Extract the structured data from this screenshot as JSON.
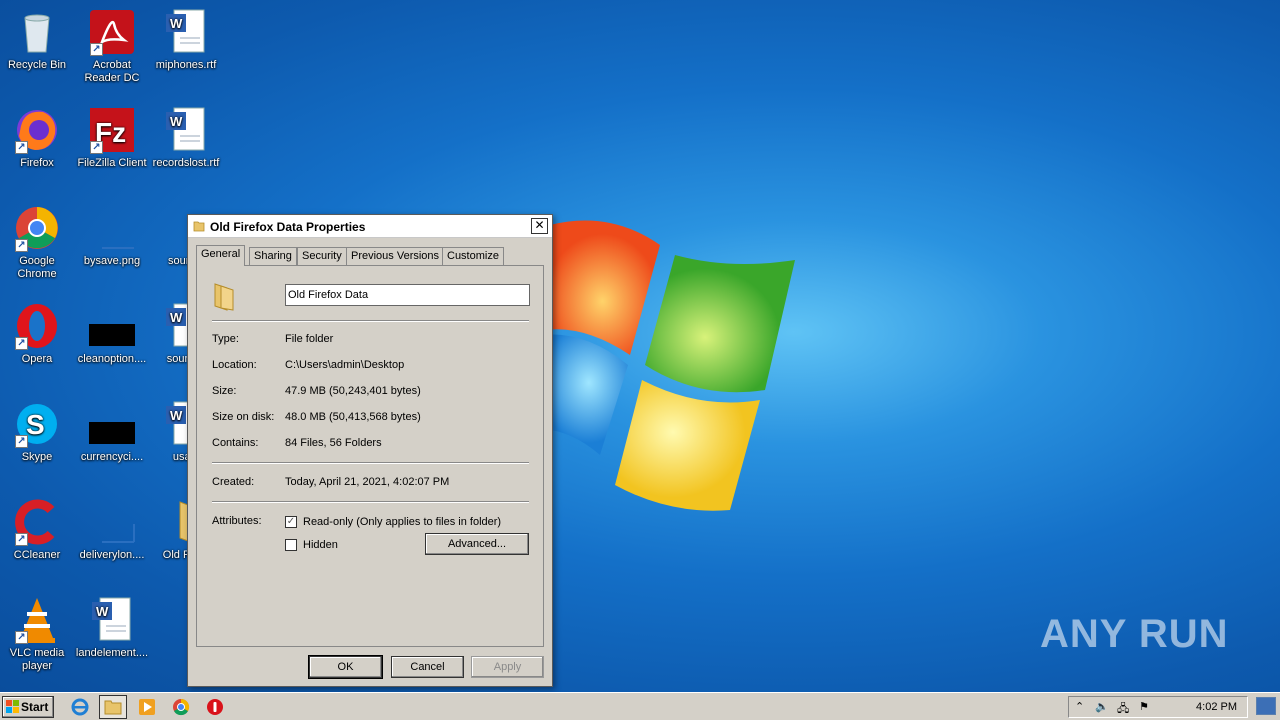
{
  "desktop": {
    "icons": [
      {
        "label": "Recycle Bin",
        "icon": "recycle-bin-icon"
      },
      {
        "label": "Acrobat Reader DC",
        "icon": "acrobat-icon"
      },
      {
        "label": "miphones.rtf",
        "icon": "word-doc-icon"
      },
      {
        "label": "Firefox",
        "icon": "firefox-icon"
      },
      {
        "label": "FileZilla Client",
        "icon": "filezilla-icon"
      },
      {
        "label": "recordslost.rtf",
        "icon": "word-doc-icon"
      },
      {
        "label": "Google Chrome",
        "icon": "chrome-icon"
      },
      {
        "label": "bysave.png",
        "icon": "image-file-icon"
      },
      {
        "label": "sounda",
        "icon": "file-icon"
      },
      {
        "label": "Opera",
        "icon": "opera-icon"
      },
      {
        "label": "cleanoption....",
        "icon": "image-file-icon"
      },
      {
        "label": "soundst",
        "icon": "word-doc-icon"
      },
      {
        "label": "Skype",
        "icon": "skype-icon"
      },
      {
        "label": "currencyci....",
        "icon": "image-file-icon"
      },
      {
        "label": "usahi",
        "icon": "word-doc-icon"
      },
      {
        "label": "CCleaner",
        "icon": "ccleaner-icon"
      },
      {
        "label": "deliverylon....",
        "icon": "image-file-icon"
      },
      {
        "label": "Old Fi Da",
        "icon": "folder-icon"
      },
      {
        "label": "VLC media player",
        "icon": "vlc-icon"
      },
      {
        "label": "landelement....",
        "icon": "word-doc-icon"
      }
    ],
    "watermark": "ANY RUN"
  },
  "dialog": {
    "title": "Old Firefox Data Properties",
    "close_glyph": "✕",
    "tabs": [
      "General",
      "Sharing",
      "Security",
      "Previous Versions",
      "Customize"
    ],
    "active_tab": "General",
    "name_value": "Old Firefox Data",
    "props": {
      "type_k": "Type:",
      "type_v": "File folder",
      "location_k": "Location:",
      "location_v": "C:\\Users\\admin\\Desktop",
      "size_k": "Size:",
      "size_v": "47.9 MB (50,243,401 bytes)",
      "sizeondisk_k": "Size on disk:",
      "sizeondisk_v": "48.0 MB (50,413,568 bytes)",
      "contains_k": "Contains:",
      "contains_v": "84 Files, 56 Folders",
      "created_k": "Created:",
      "created_v": "Today, April 21, 2021, 4:02:07 PM",
      "attributes_k": "Attributes:"
    },
    "readonly_label": "Read-only (Only applies to files in folder)",
    "readonly_checked": true,
    "hidden_label": "Hidden",
    "hidden_checked": false,
    "advanced_label": "Advanced...",
    "ok_label": "OK",
    "cancel_label": "Cancel",
    "apply_label": "Apply"
  },
  "taskbar": {
    "start_label": "Start",
    "clock": "4:02 PM"
  }
}
